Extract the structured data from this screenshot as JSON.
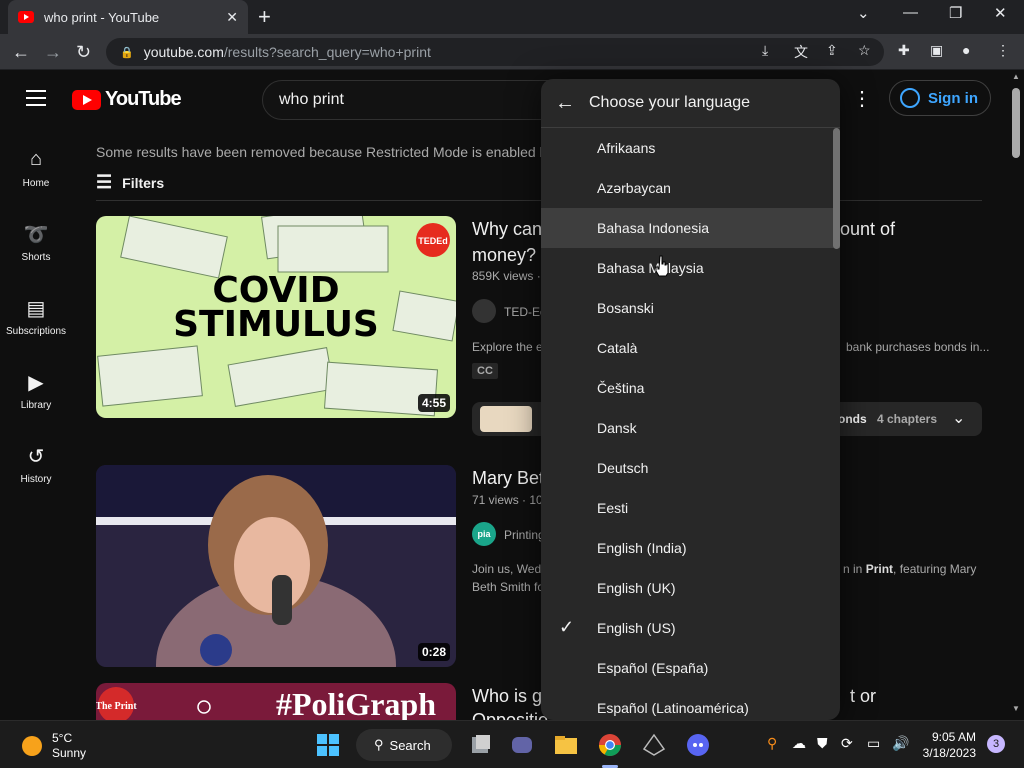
{
  "browser": {
    "tab_title": "who print - YouTube",
    "new_tab": "+",
    "url_host": "youtube.com",
    "url_path": "/results?search_query=who+print"
  },
  "header": {
    "logo_text": "YouTube",
    "search_value": "who print",
    "signin_label": "Sign in"
  },
  "guide": {
    "items": [
      {
        "label": "Home",
        "icon": "home-icon"
      },
      {
        "label": "Shorts",
        "icon": "shorts-icon"
      },
      {
        "label": "Subscriptions",
        "icon": "subscriptions-icon"
      },
      {
        "label": "Library",
        "icon": "library-icon"
      },
      {
        "label": "History",
        "icon": "history-icon"
      }
    ]
  },
  "results": {
    "restricted_notice": "Some results have been removed because Restricted Mode is enabled b",
    "filters_label": "Filters",
    "videos": [
      {
        "title_line1": "Why can'",
        "title_line1_end": "ount of",
        "title_line2": "money? -",
        "meta": "859K views ·",
        "channel": "TED-Ed",
        "desc_start": "Explore the e",
        "desc_end": "bank purchases bonds in...",
        "badge": "CC",
        "duration": "4:55",
        "thumb_text_line1": "COVID",
        "thumb_text_line2": "STIMULUS",
        "thumb_badge": "TEDEd",
        "chapter_prefix": "onds",
        "chapters": "4 chapters"
      },
      {
        "title": "Mary Bet",
        "meta": "71 views · 10",
        "channel": "Printing",
        "channel_badge": "pia",
        "desc_line1_start": "Join us, Wed",
        "desc_line1_end_a": "n in ",
        "desc_line1_end_b": "Print",
        "desc_line1_end_c": ", featuring Mary",
        "desc_line2": "Beth Smith fo",
        "duration": "0:28"
      },
      {
        "title_start": "Who is g",
        "title_end": "t or",
        "title_line2": "Oppositio",
        "thumb_text": "#PoliGraph",
        "thumb_badge": "The Print"
      }
    ]
  },
  "language_menu": {
    "title": "Choose your language",
    "items": [
      {
        "label": "Afrikaans",
        "selected": false
      },
      {
        "label": "Azərbaycan",
        "selected": false
      },
      {
        "label": "Bahasa Indonesia",
        "selected": false,
        "hovered": true
      },
      {
        "label": "Bahasa Malaysia",
        "selected": false
      },
      {
        "label": "Bosanski",
        "selected": false
      },
      {
        "label": "Català",
        "selected": false
      },
      {
        "label": "Čeština",
        "selected": false
      },
      {
        "label": "Dansk",
        "selected": false
      },
      {
        "label": "Deutsch",
        "selected": false
      },
      {
        "label": "Eesti",
        "selected": false
      },
      {
        "label": "English (India)",
        "selected": false
      },
      {
        "label": "English (UK)",
        "selected": false
      },
      {
        "label": "English (US)",
        "selected": true
      },
      {
        "label": "Español (España)",
        "selected": false
      },
      {
        "label": "Español (Latinoamérica)",
        "selected": false
      }
    ]
  },
  "taskbar": {
    "temperature": "5°C",
    "condition": "Sunny",
    "search_label": "Search",
    "time": "9:05 AM",
    "date": "3/18/2023",
    "notifications": "3"
  },
  "colors": {
    "background": "#0f0f0f",
    "menu_bg": "#282828",
    "link_blue": "#3ea6ff",
    "yt_red": "#ff0000",
    "thumb_green": "#d4f0a6"
  }
}
